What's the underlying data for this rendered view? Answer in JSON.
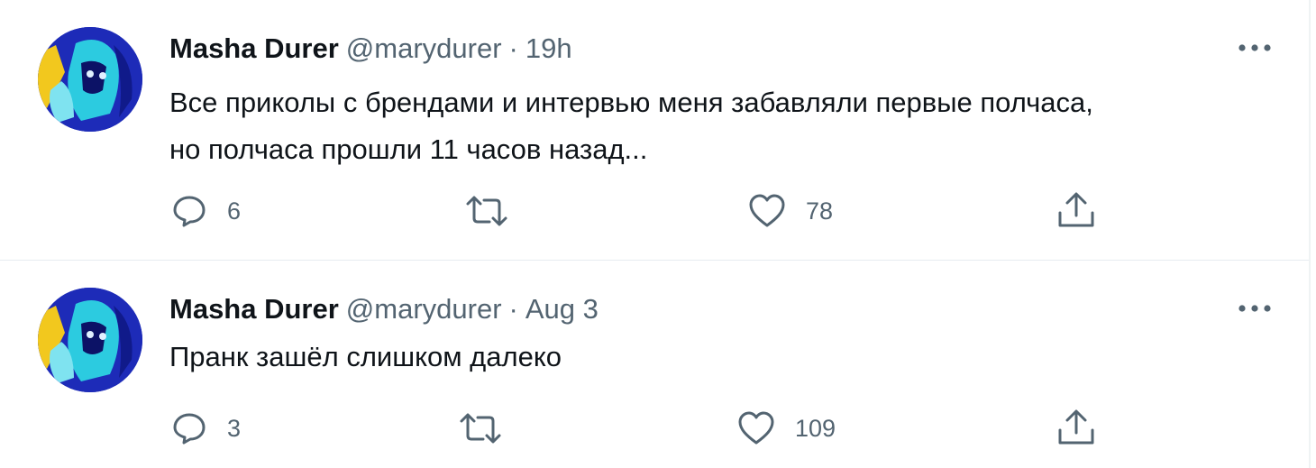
{
  "tweets": [
    {
      "author_name": "Masha Durer",
      "handle": "@marydurer",
      "separator": "·",
      "time": "19h",
      "text_lines": [
        "Все приколы с брендами и интервью меня забавляли первые полчаса,",
        "но полчаса прошли 11 часов назад..."
      ],
      "replies": "6",
      "retweets": "",
      "likes": "78"
    },
    {
      "author_name": "Masha Durer",
      "handle": "@marydurer",
      "separator": "·",
      "time": "Aug 3",
      "text_lines": [
        "Пранк зашёл слишком далеко"
      ],
      "replies": "3",
      "retweets": "",
      "likes": "109"
    }
  ],
  "icons": {
    "reply": "speech-bubble-icon",
    "retweet": "retweet-arrows-icon",
    "like": "heart-icon",
    "share": "share-upload-icon",
    "more": "more-dots-icon"
  },
  "colors": {
    "text": "#0f1419",
    "secondary": "#536471",
    "divider": "#e6ecf0",
    "avatar_bg": "#1d2bb8"
  }
}
